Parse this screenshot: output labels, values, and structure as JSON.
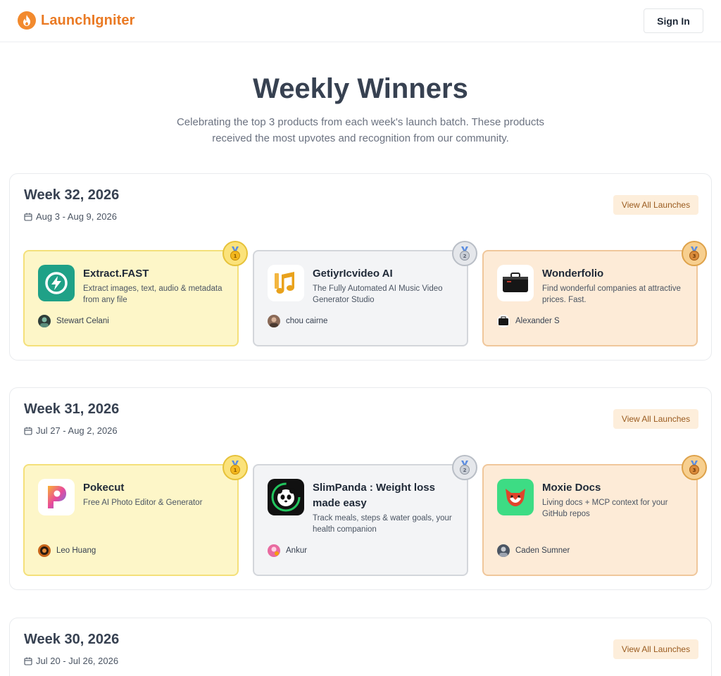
{
  "header": {
    "brand": "LaunchIgniter",
    "sign_in": "Sign In"
  },
  "hero": {
    "title": "Weekly Winners",
    "subtitle": "Celebrating the top 3 products from each week's launch batch. These products received the most upvotes and recognition from our community."
  },
  "colors": {
    "accent": "#ea7a24",
    "gold_card": "#fdf6c8",
    "silver_card": "#f3f4f6",
    "bronze_card": "#fdebd7"
  },
  "weeks": [
    {
      "title": "Week 32, 2026",
      "dates": "Aug 3 - Aug 9, 2026",
      "view_all": "View All Launches",
      "products": [
        {
          "rank": "gold",
          "name": "Extract.FAST",
          "description": "Extract images, text, audio & metadata from any file",
          "maker": "Stewart Celani",
          "icon": "lightning-icon"
        },
        {
          "rank": "silver",
          "name": "GetiyrIcvideo AI",
          "description": "The Fully Automated AI Music Video Generator Studio",
          "maker": "chou cairne",
          "icon": "music-note-icon"
        },
        {
          "rank": "bronze",
          "name": "Wonderfolio",
          "description": "Find wonderful companies at attractive prices. Fast.",
          "maker": "Alexander S",
          "icon": "briefcase-icon"
        }
      ]
    },
    {
      "title": "Week 31, 2026",
      "dates": "Jul 27 - Aug 2, 2026",
      "view_all": "View All Launches",
      "products": [
        {
          "rank": "gold",
          "name": "Pokecut",
          "description": "Free AI Photo Editor & Generator",
          "maker": "Leo Huang",
          "icon": "p-letter-icon"
        },
        {
          "rank": "silver",
          "name": "SlimPanda : Weight loss made easy",
          "description": "Track meals, steps & water goals, your health companion",
          "maker": "Ankur",
          "icon": "panda-icon"
        },
        {
          "rank": "bronze",
          "name": "Moxie Docs",
          "description": "Living docs + MCP context for your GitHub repos",
          "maker": "Caden Sumner",
          "icon": "fox-icon"
        }
      ]
    },
    {
      "title": "Week 30, 2026",
      "dates": "Jul 20 - Jul 26, 2026",
      "view_all": "View All Launches",
      "products": []
    }
  ]
}
